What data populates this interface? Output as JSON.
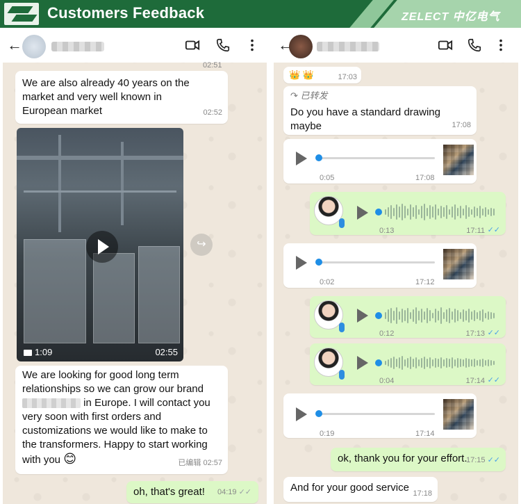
{
  "banner": {
    "title": "Customers Feedback",
    "brand": "ZELECT 中亿电气",
    "color": "#1e6b3a"
  },
  "left": {
    "header": {
      "back_icon": "←",
      "icons": [
        "video-call-icon",
        "phone-icon",
        "more-icon"
      ]
    },
    "messages": {
      "m0_time": "02:51",
      "m1_text": "We are also already 40 years on the market and very well known in European market",
      "m1_time": "02:52",
      "video_duration": "1:09",
      "video_time": "02:55",
      "m2_line1": "We are looking for good long term relationships so we can grow our brand",
      "m2_line2": "in Europe. I will contact you very soon with first orders and customizations we would like to make to the transformers. Happy to start working with you",
      "m2_emoji": "😊",
      "m2_edited": "已编辑",
      "m2_time": "02:57",
      "m3_text": "oh, that's great!",
      "m3_time": "04:19",
      "m3_ticks": "✓✓"
    }
  },
  "right": {
    "header": {
      "back_icon": "←",
      "icons": [
        "video-call-icon",
        "phone-icon",
        "more-icon"
      ]
    },
    "messages": {
      "r0_emoji": "👑 👑",
      "r0_time": "17:03",
      "r1_forward": "↷ 已转发",
      "r1_text": "Do you have a standard drawing maybe",
      "r1_time": "17:08",
      "v1_duration": "0:05",
      "v1_time": "17:08",
      "v2_duration": "0:13",
      "v2_time": "17:11",
      "v3_duration": "0:02",
      "v3_time": "17:12",
      "v4_duration": "0:12",
      "v4_time": "17:13",
      "v5_duration": "0:04",
      "v5_time": "17:14",
      "v6_duration": "0:19",
      "v6_time": "17:14",
      "r2_text": "ok, thank you for your effort.",
      "r2_time": "17:15",
      "r3_text": "And for your good service",
      "r3_time": "17:18",
      "ticks": "✓✓"
    }
  }
}
